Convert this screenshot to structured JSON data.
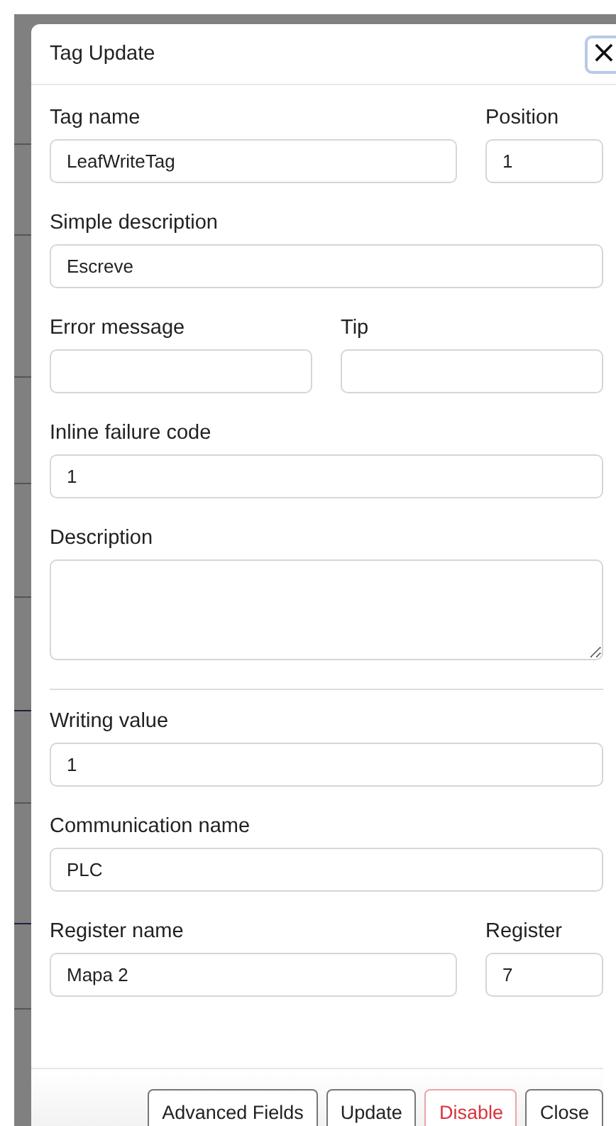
{
  "dialog": {
    "title": "Tag Update",
    "close_icon": "×"
  },
  "sections": [
    {
      "rows": [
        [
          {
            "label": "Tag name",
            "kind": "text",
            "value": "LeafWriteTag"
          },
          {
            "label": "Position",
            "kind": "short",
            "value": "1"
          }
        ],
        [
          {
            "label": "Simple description",
            "kind": "text",
            "value": "Escreve"
          }
        ],
        [
          {
            "label": "Error message",
            "kind": "text"
          },
          {
            "label": "Tip",
            "kind": "text"
          }
        ],
        [
          {
            "label": "Inline failure code",
            "kind": "text",
            "value": "1"
          }
        ],
        [
          {
            "label": "Description",
            "kind": "textarea"
          }
        ]
      ]
    },
    {
      "rows": [
        [
          {
            "label": "Writing value",
            "kind": "text",
            "value": "1"
          }
        ],
        [
          {
            "label": "Communication name",
            "kind": "text",
            "value": "PLC"
          }
        ],
        [
          {
            "label": "Register name",
            "kind": "text",
            "value": "Mapa 2"
          },
          {
            "label": "Register",
            "kind": "short",
            "value": "7"
          }
        ]
      ]
    }
  ],
  "buttons": [
    {
      "label": "Advanced Fields",
      "kind": "default"
    },
    {
      "label": "Update",
      "kind": "default"
    },
    {
      "label": "Disable",
      "kind": "danger"
    },
    {
      "label": "Close",
      "kind": "default"
    }
  ]
}
